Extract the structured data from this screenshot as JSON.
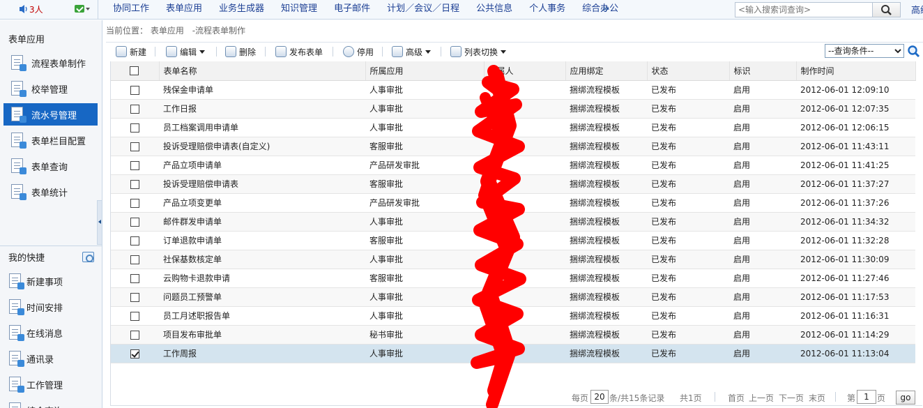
{
  "topbar": {
    "online_prefix": "",
    "online_count": "3人",
    "nav": [
      "协同工作",
      "表单应用",
      "业务生成器",
      "知识管理",
      "电子邮件",
      "计划／会议／日程",
      "公共信息",
      "个人事务",
      "综合办公"
    ],
    "more": "»",
    "search_placeholder": "<输入搜索词查询>",
    "right_text": "高级"
  },
  "sidebar": {
    "section1_title": "表单应用",
    "items": [
      {
        "label": "流程表单制作",
        "icon": "form-flow-icon"
      },
      {
        "label": "校举管理",
        "icon": "enum-manage-icon"
      },
      {
        "label": "流水号管理",
        "icon": "serial-number-icon",
        "active": true
      },
      {
        "label": "表单栏目配置",
        "icon": "form-column-config-icon"
      },
      {
        "label": "表单查询",
        "icon": "form-query-icon"
      },
      {
        "label": "表单统计",
        "icon": "form-stats-icon"
      }
    ],
    "section2_title": "我的快捷",
    "shortcuts": [
      {
        "label": "新建事项",
        "icon": "new-item-icon"
      },
      {
        "label": "时间安排",
        "icon": "schedule-icon"
      },
      {
        "label": "在线消息",
        "icon": "online-message-icon"
      },
      {
        "label": "通讯录",
        "icon": "contacts-icon"
      },
      {
        "label": "工作管理",
        "icon": "work-manage-icon"
      },
      {
        "label": "综合查询",
        "icon": "comprehensive-query-icon"
      }
    ]
  },
  "breadcrumb": {
    "prefix": "当前位置：",
    "path": "表单应用",
    "current": "-流程表单制作"
  },
  "toolbar": {
    "new": "新建",
    "edit": "编辑",
    "delete": "删除",
    "publish": "发布表单",
    "disable": "停用",
    "advanced": "高级",
    "switch_view": "列表切换",
    "query_select": "--查询条件--"
  },
  "table": {
    "columns": [
      "表单名称",
      "所属应用",
      "所属人",
      "应用绑定",
      "状态",
      "标识",
      "制作时间"
    ],
    "rows": [
      {
        "name": "残保金申请单",
        "app": "人事审批",
        "owner": "",
        "bind": "捆绑流程模板",
        "status": "已发布",
        "flag": "启用",
        "time": "2012-06-01 12:09:10",
        "checked": false
      },
      {
        "name": "工作日报",
        "app": "人事审批",
        "owner": "",
        "bind": "捆绑流程模板",
        "status": "已发布",
        "flag": "启用",
        "time": "2012-06-01 12:07:35",
        "checked": false
      },
      {
        "name": "员工档案调用申请单",
        "app": "人事审批",
        "owner": "",
        "bind": "捆绑流程模板",
        "status": "已发布",
        "flag": "启用",
        "time": "2012-06-01 12:06:15",
        "checked": false
      },
      {
        "name": "投诉受理赔偿申请表(自定义)",
        "app": "客服审批",
        "owner": "",
        "bind": "捆绑流程模板",
        "status": "已发布",
        "flag": "启用",
        "time": "2012-06-01 11:43:11",
        "checked": false
      },
      {
        "name": "产品立项申请单",
        "app": "产品研发审批",
        "owner": "",
        "bind": "捆绑流程模板",
        "status": "已发布",
        "flag": "启用",
        "time": "2012-06-01 11:41:25",
        "checked": false
      },
      {
        "name": "投诉受理赔偿申请表",
        "app": "客服审批",
        "owner": "",
        "bind": "捆绑流程模板",
        "status": "已发布",
        "flag": "启用",
        "time": "2012-06-01 11:37:27",
        "checked": false
      },
      {
        "name": "产品立项变更单",
        "app": "产品研发审批",
        "owner": "",
        "bind": "捆绑流程模板",
        "status": "已发布",
        "flag": "启用",
        "time": "2012-06-01 11:37:26",
        "checked": false
      },
      {
        "name": "邮件群发申请单",
        "app": "人事审批",
        "owner": "",
        "bind": "捆绑流程模板",
        "status": "已发布",
        "flag": "启用",
        "time": "2012-06-01 11:34:32",
        "checked": false
      },
      {
        "name": "订单退款申请单",
        "app": "客服审批",
        "owner": "",
        "bind": "捆绑流程模板",
        "status": "已发布",
        "flag": "启用",
        "time": "2012-06-01 11:32:28",
        "checked": false
      },
      {
        "name": "社保基数核定单",
        "app": "人事审批",
        "owner": "",
        "bind": "捆绑流程模板",
        "status": "已发布",
        "flag": "启用",
        "time": "2012-06-01 11:30:09",
        "checked": false
      },
      {
        "name": "云购物卡退款申请",
        "app": "客服审批",
        "owner": "",
        "bind": "捆绑流程模板",
        "status": "已发布",
        "flag": "启用",
        "time": "2012-06-01 11:27:46",
        "checked": false
      },
      {
        "name": "问题员工预警单",
        "app": "人事审批",
        "owner": "",
        "bind": "捆绑流程模板",
        "status": "已发布",
        "flag": "启用",
        "time": "2012-06-01 11:17:53",
        "checked": false
      },
      {
        "name": "员工月述职报告单",
        "app": "人事审批",
        "owner": "",
        "bind": "捆绑流程模板",
        "status": "已发布",
        "flag": "启用",
        "time": "2012-06-01 11:16:31",
        "checked": false
      },
      {
        "name": "项目发布审批单",
        "app": "秘书审批",
        "owner": "",
        "bind": "捆绑流程模板",
        "status": "已发布",
        "flag": "启用",
        "time": "2012-06-01 11:14:29",
        "checked": false
      },
      {
        "name": "工作周报",
        "app": "人事审批",
        "owner": "",
        "bind": "捆绑流程模板",
        "status": "已发布",
        "flag": "启用",
        "time": "2012-06-01 11:13:04",
        "checked": true
      }
    ]
  },
  "pager": {
    "per_page_label": "每页",
    "per_page_value": "20",
    "total_label": "条/共15条记录",
    "pages_label": "共1页",
    "first": "首页",
    "prev": "上一页",
    "next": "下一页",
    "last": "末页",
    "goto_label": "第",
    "page_value": "1",
    "page_suffix": "页",
    "go": "go"
  },
  "colors": {
    "accent": "#1767c4",
    "nav_text": "#1c3f94",
    "selected_row": "#d4e4ef",
    "redaction": "#ff0000"
  }
}
